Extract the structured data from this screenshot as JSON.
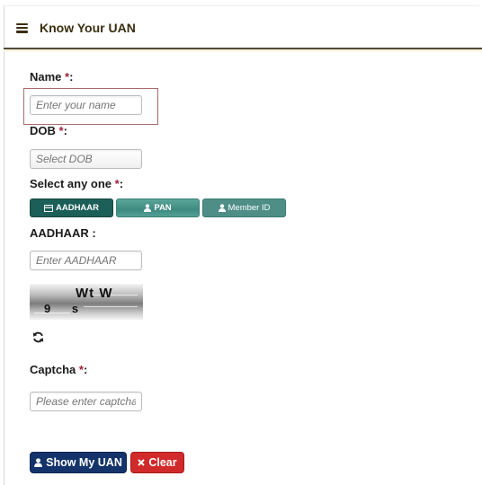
{
  "header": {
    "title": "Know Your UAN",
    "menu_icon": "hamburger-icon"
  },
  "form": {
    "name": {
      "label": "Name",
      "required": "*",
      "suffix": ":",
      "placeholder": "Enter your name"
    },
    "dob": {
      "label": "DOB",
      "required": "*",
      "suffix": ":",
      "placeholder": "Select DOB"
    },
    "select_one": {
      "label": "Select any one",
      "required": "*",
      "suffix": ":",
      "options": [
        {
          "label": "AADHAAR",
          "icon": "id-card-icon",
          "selected": true
        },
        {
          "label": "PAN",
          "icon": "user-icon",
          "selected": false
        },
        {
          "label": "Member ID",
          "icon": "user-icon",
          "selected": false
        }
      ]
    },
    "aadhaar": {
      "label": "AADHAAR",
      "suffix": ":",
      "placeholder": "Enter AADHAAR"
    },
    "captcha_image": {
      "line1": "Wt W",
      "line2": "9 s"
    },
    "captcha": {
      "label": "Captcha",
      "required": "*",
      "suffix": ":",
      "placeholder": "Please enter captcha"
    }
  },
  "buttons": {
    "show_uan": "Show My UAN",
    "clear": "Clear"
  },
  "colors": {
    "title": "#3a2e10",
    "required": "#a0213f",
    "toggle_active": "#1c5f58",
    "toggle_inactive": "#4e8e86",
    "primary": "#14336a",
    "danger": "#d12a2a"
  }
}
